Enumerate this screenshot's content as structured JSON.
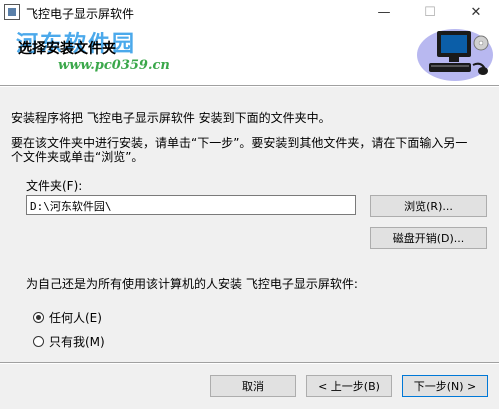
{
  "window": {
    "title": "飞控电子显示屏软件",
    "minimize": "—",
    "maximize": "☐",
    "close": "✕"
  },
  "header": {
    "title": "选择安装文件夹",
    "watermark_name": "河东软件园",
    "watermark_url": "www.pc0359.cn"
  },
  "body": {
    "intro": "安装程序将把 飞控电子显示屏软件 安装到下面的文件夹中。",
    "instruction_line1": "要在该文件夹中进行安装，请单击“下一步”。要安装到其他文件夹，请在下面输入另一",
    "instruction_line2": "个文件夹或单击“浏览”。",
    "folder_label": "文件夹(F):",
    "folder_value": "D:\\河东软件园\\",
    "browse_button": "浏览(R)...",
    "disk_cost_button": "磁盘开销(D)...",
    "install_for_label": "为自己还是为所有使用该计算机的人安装 飞控电子显示屏软件:",
    "options": [
      {
        "label": "任何人(E)",
        "selected": true
      },
      {
        "label": "只有我(M)",
        "selected": false
      }
    ]
  },
  "footer": {
    "cancel": "取消",
    "back": "< 上一步(B)",
    "next": "下一步(N) >"
  },
  "colors": {
    "accent": "#0078d7",
    "watermark_blue": "#2c9be8",
    "watermark_green": "#3aa74a"
  }
}
